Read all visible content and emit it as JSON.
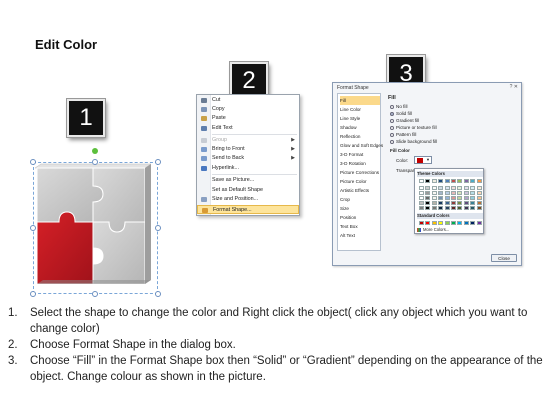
{
  "title": "Edit Color",
  "steps": [
    "1",
    "2",
    "3"
  ],
  "context_menu": {
    "items": [
      {
        "label": "Cut",
        "icon": "scissors-icon",
        "disabled": false,
        "arrow": false
      },
      {
        "label": "Copy",
        "icon": "copy-icon",
        "disabled": false,
        "arrow": false
      },
      {
        "label": "Paste",
        "icon": "paste-icon",
        "disabled": false,
        "arrow": false
      },
      {
        "label": "Edit Text",
        "icon": "edit-text-icon",
        "disabled": false,
        "arrow": false
      },
      {
        "label": "Group",
        "icon": "group-icon",
        "disabled": true,
        "arrow": true
      },
      {
        "label": "Bring to Front",
        "icon": "bring-front-icon",
        "disabled": false,
        "arrow": true
      },
      {
        "label": "Send to Back",
        "icon": "send-back-icon",
        "disabled": false,
        "arrow": true
      },
      {
        "label": "Hyperlink...",
        "icon": "hyperlink-icon",
        "disabled": false,
        "arrow": false
      },
      {
        "label": "Save as Picture...",
        "icon": "",
        "disabled": false,
        "arrow": false
      },
      {
        "label": "Set as Default Shape",
        "icon": "",
        "disabled": false,
        "arrow": false
      },
      {
        "label": "Size and Position...",
        "icon": "size-position-icon",
        "disabled": false,
        "arrow": false
      },
      {
        "label": "Format Shape...",
        "icon": "format-shape-icon",
        "disabled": false,
        "arrow": false
      }
    ]
  },
  "format_dialog": {
    "title": "Format Shape",
    "title_buttons": "? ✕",
    "categories": [
      "Fill",
      "Line Color",
      "Line Style",
      "Shadow",
      "Reflection",
      "Glow and Soft Edges",
      "3-D Format",
      "3-D Rotation",
      "Picture Corrections",
      "Picture Color",
      "Artistic Effects",
      "Crop",
      "Size",
      "Position",
      "Text Box",
      "Alt Text"
    ],
    "selected_category": "Fill",
    "fill_header": "Fill",
    "options": [
      "No fill",
      "Solid fill",
      "Gradient fill",
      "Picture or texture fill",
      "Pattern fill",
      "Slide background fill"
    ],
    "selected_option": "Solid fill",
    "fill_color_label": "Fill Color",
    "color_label": "Color:",
    "transparency_label": "Transparency:",
    "close_label": "Close"
  },
  "color_popup": {
    "theme_header": "Theme Colors",
    "standard_header": "Standard Colors",
    "more_colors": "More Colors...",
    "theme_top": [
      "#ffffff",
      "#000000",
      "#eeece1",
      "#1f497d",
      "#4f81bd",
      "#c0504d",
      "#9bbb59",
      "#8064a2",
      "#4bacc6",
      "#f79646"
    ],
    "standard": [
      "#c00000",
      "#ff0000",
      "#ffc000",
      "#ffff00",
      "#92d050",
      "#00b050",
      "#00b0f0",
      "#0070c0",
      "#002060",
      "#7030a0"
    ]
  },
  "puzzle_colors": {
    "red": "#c8171d",
    "gray": "#c9c9c9"
  },
  "instructions": [
    {
      "num": "1.",
      "text": "Select the shape to change the color and Right click the object( click any object which you want to change color)"
    },
    {
      "num": "2.",
      "text": "Choose Format Shape in the dialog box."
    },
    {
      "num": "3.",
      "text": "Choose “Fill” in the Format Shape box then “Solid” or “Gradient” depending on the appearance of the object. Change colour as shown in the picture."
    }
  ]
}
